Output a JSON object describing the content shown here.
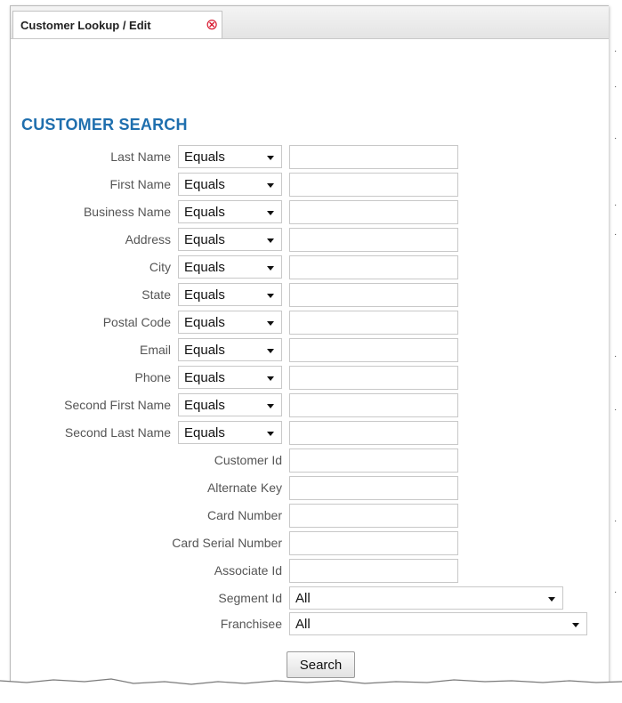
{
  "tab": {
    "title": "Customer Lookup / Edit",
    "close_symbol": "⊗"
  },
  "form": {
    "heading": "CUSTOMER SEARCH",
    "operator_rows": [
      {
        "label": "Last Name",
        "operator": "Equals",
        "value": ""
      },
      {
        "label": "First Name",
        "operator": "Equals",
        "value": ""
      },
      {
        "label": "Business Name",
        "operator": "Equals",
        "value": ""
      },
      {
        "label": "Address",
        "operator": "Equals",
        "value": ""
      },
      {
        "label": "City",
        "operator": "Equals",
        "value": ""
      },
      {
        "label": "State",
        "operator": "Equals",
        "value": ""
      },
      {
        "label": "Postal Code",
        "operator": "Equals",
        "value": ""
      },
      {
        "label": "Email",
        "operator": "Equals",
        "value": ""
      },
      {
        "label": "Phone",
        "operator": "Equals",
        "value": ""
      },
      {
        "label": "Second First Name",
        "operator": "Equals",
        "value": ""
      },
      {
        "label": "Second Last Name",
        "operator": "Equals",
        "value": ""
      }
    ],
    "plain_rows": [
      {
        "label": "Customer Id",
        "value": ""
      },
      {
        "label": "Alternate Key",
        "value": ""
      },
      {
        "label": "Card Number",
        "value": ""
      },
      {
        "label": "Card Serial Number",
        "value": ""
      },
      {
        "label": "Associate Id",
        "value": ""
      }
    ],
    "select_rows": [
      {
        "label": "Segment Id",
        "selected": "All"
      },
      {
        "label": "Franchisee",
        "selected": "All"
      }
    ],
    "search_label": "Search"
  }
}
